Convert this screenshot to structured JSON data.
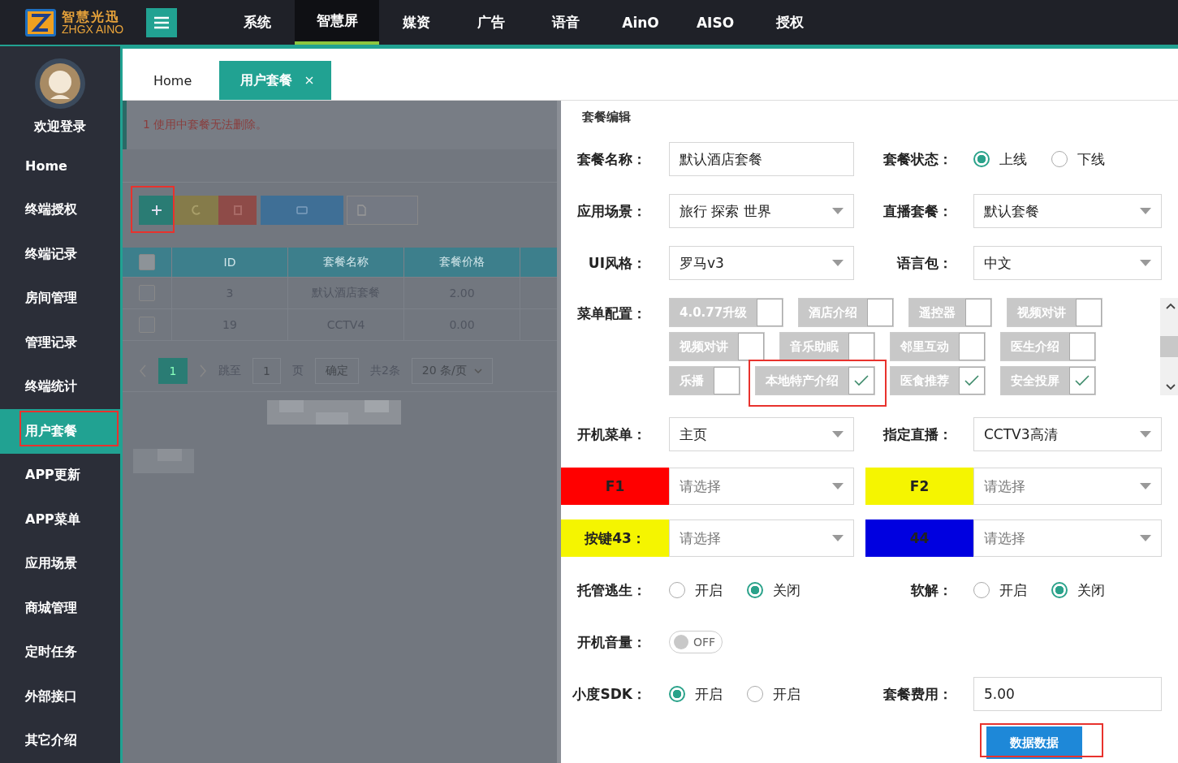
{
  "logo": {
    "line1": "智慧光迅",
    "line2": "ZHGX AINO"
  },
  "top_nav": [
    {
      "label": "系统",
      "selected": false
    },
    {
      "label": "智慧屏",
      "selected": true
    },
    {
      "label": "媒资",
      "selected": false
    },
    {
      "label": "广告",
      "selected": false
    },
    {
      "label": "语音",
      "selected": false
    },
    {
      "label": "AinO",
      "selected": false
    },
    {
      "label": "AISO",
      "selected": false
    },
    {
      "label": "授权",
      "selected": false
    }
  ],
  "sidebar": {
    "user": "欢迎登录",
    "items": [
      {
        "label": "Home",
        "selected": false,
        "annotated": false
      },
      {
        "label": "终端授权",
        "selected": false,
        "annotated": false
      },
      {
        "label": "终端记录",
        "selected": false,
        "annotated": false
      },
      {
        "label": "房间管理",
        "selected": false,
        "annotated": false
      },
      {
        "label": "管理记录",
        "selected": false,
        "annotated": false
      },
      {
        "label": "终端统计",
        "selected": false,
        "annotated": false
      },
      {
        "label": "用户套餐",
        "selected": true,
        "annotated": true
      },
      {
        "label": "APP更新",
        "selected": false,
        "annotated": false
      },
      {
        "label": "APP菜单",
        "selected": false,
        "annotated": false
      },
      {
        "label": "应用场景",
        "selected": false,
        "annotated": false
      },
      {
        "label": "商城管理",
        "selected": false,
        "annotated": false
      },
      {
        "label": "定时任务",
        "selected": false,
        "annotated": false
      },
      {
        "label": "外部接口",
        "selected": false,
        "annotated": false
      },
      {
        "label": "其它介绍",
        "selected": false,
        "annotated": false
      }
    ]
  },
  "tabs": [
    {
      "label": "Home",
      "selected": false,
      "closable": false
    },
    {
      "label": "用户套餐",
      "selected": true,
      "closable": true
    }
  ],
  "list_pane": {
    "notice": "1 使用中套餐无法删除。",
    "toolbar": [
      {
        "kind": "add",
        "annotated": true
      },
      {
        "kind": "edit",
        "annotated": false
      },
      {
        "kind": "delete",
        "annotated": false
      },
      {
        "kind": "export",
        "annotated": false
      },
      {
        "kind": "doc",
        "annotated": false
      }
    ],
    "header_checked": false,
    "columns": [
      "ID",
      "套餐名称",
      "套餐价格"
    ],
    "rows": [
      {
        "checked": false,
        "cells": [
          "3",
          "默认酒店套餐",
          "2.00"
        ]
      },
      {
        "checked": false,
        "cells": [
          "19",
          "CCTV4",
          "0.00"
        ]
      }
    ],
    "pagination": {
      "current": "1",
      "goto_label": "跳至",
      "page_value": "1",
      "page_unit": "页",
      "confirm": "确定",
      "total": "共2条",
      "page_size": "20 条/页"
    }
  },
  "form": {
    "title": "套餐编辑",
    "rows": [
      {
        "fields": [
          {
            "kind": "text",
            "label": "套餐名称：",
            "value": "默认酒店套餐"
          },
          {
            "kind": "radio",
            "label": "套餐状态：",
            "options": [
              {
                "label": "上线",
                "selected": true
              },
              {
                "label": "下线",
                "selected": false
              }
            ]
          }
        ]
      },
      {
        "fields": [
          {
            "kind": "select",
            "label": "应用场景：",
            "value": "旅行 探索 世界"
          },
          {
            "kind": "select",
            "label": "直播套餐：",
            "value": "默认套餐"
          }
        ]
      },
      {
        "fields": [
          {
            "kind": "select",
            "label": "UI风格：",
            "value": "罗马v3"
          },
          {
            "kind": "select",
            "label": "语言包：",
            "value": "中文"
          }
        ]
      },
      {
        "fields": [
          {
            "kind": "menu",
            "label": "菜单配置：",
            "items": [
              {
                "label": "4.0.77升级",
                "checked": false,
                "annotated": false
              },
              {
                "label": "酒店介绍",
                "checked": false,
                "annotated": false
              },
              {
                "label": "遥控器",
                "checked": false,
                "annotated": false
              },
              {
                "label": "视频对讲",
                "checked": false,
                "annotated": false
              },
              {
                "label": "视频对讲",
                "checked": false,
                "annotated": false
              },
              {
                "label": "音乐助眠",
                "checked": false,
                "annotated": false
              },
              {
                "label": "邻里互动",
                "checked": false,
                "annotated": false
              },
              {
                "label": "医生介绍",
                "checked": false,
                "annotated": false
              },
              {
                "label": "乐播",
                "checked": false,
                "annotated": false
              },
              {
                "label": "本地特产介绍",
                "checked": true,
                "annotated": true
              },
              {
                "label": "医食推荐",
                "checked": true,
                "annotated": false
              },
              {
                "label": "安全投屏",
                "checked": true,
                "annotated": false
              }
            ]
          }
        ]
      },
      {
        "fields": [
          {
            "kind": "select",
            "label": "开机菜单：",
            "value": "主页"
          },
          {
            "kind": "select",
            "label": "指定直播：",
            "value": "CCTV3高清"
          }
        ]
      },
      {
        "fields": [
          {
            "kind": "key",
            "label": "F1",
            "color": "#ff0000",
            "placeholder": "请选择"
          },
          {
            "kind": "key",
            "label": "F2",
            "color": "#f5f500",
            "placeholder": "请选择"
          }
        ]
      },
      {
        "fields": [
          {
            "kind": "key",
            "label": "按键43：",
            "color": "#f5f500",
            "placeholder": "请选择"
          },
          {
            "kind": "key",
            "label": "44",
            "color": "#0000e0",
            "placeholder": "请选择"
          }
        ]
      },
      {
        "fields": [
          {
            "kind": "radio",
            "label": "托管逃生：",
            "options": [
              {
                "label": "开启",
                "selected": false
              },
              {
                "label": "关闭",
                "selected": true
              }
            ]
          },
          {
            "kind": "radio",
            "label": "软解：",
            "options": [
              {
                "label": "开启",
                "selected": false
              },
              {
                "label": "关闭",
                "selected": true
              }
            ]
          }
        ]
      },
      {
        "fields": [
          {
            "kind": "toggle",
            "label": "开机音量：",
            "on": false,
            "text": "OFF"
          }
        ]
      },
      {
        "fields": [
          {
            "kind": "radio",
            "label": "小度SDK：",
            "options": [
              {
                "label": "开启",
                "selected": true
              },
              {
                "label": "开启",
                "selected": false
              }
            ]
          },
          {
            "kind": "text",
            "label": "套餐费用：",
            "value": "5.00"
          }
        ]
      }
    ],
    "submit": {
      "label": "数据数据",
      "annotated": true
    }
  }
}
